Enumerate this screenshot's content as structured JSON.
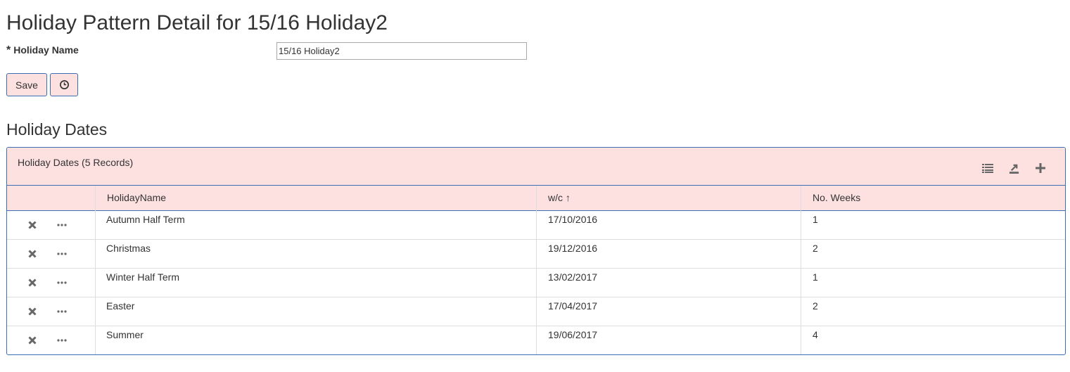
{
  "page": {
    "title": "Holiday Pattern Detail for 15/16 Holiday2"
  },
  "form": {
    "required_mark": "*",
    "holiday_name_label": "Holiday Name",
    "holiday_name_value": "15/16 Holiday2"
  },
  "buttons": {
    "save_label": "Save",
    "history_icon": "clock-icon"
  },
  "section": {
    "title": "Holiday Dates"
  },
  "grid": {
    "title": "Holiday Dates (5 Records)",
    "toolbar_icons": [
      "list-icon",
      "export-icon",
      "plus-icon"
    ],
    "columns": [
      "HolidayName",
      "w/c ↑",
      "No. Weeks"
    ],
    "row_icons": [
      "close-icon",
      "ellipsis-icon"
    ],
    "rows": [
      {
        "name": "Autumn Half Term",
        "wc": "17/10/2016",
        "weeks": "1"
      },
      {
        "name": "Christmas",
        "wc": "19/12/2016",
        "weeks": "2"
      },
      {
        "name": "Winter Half Term",
        "wc": "13/02/2017",
        "weeks": "1"
      },
      {
        "name": "Easter",
        "wc": "17/04/2017",
        "weeks": "2"
      },
      {
        "name": "Summer",
        "wc": "19/06/2017",
        "weeks": "4"
      }
    ]
  },
  "colors": {
    "accent_bg": "#fde0e0",
    "border": "#3c6eb4",
    "icon": "#666666"
  }
}
